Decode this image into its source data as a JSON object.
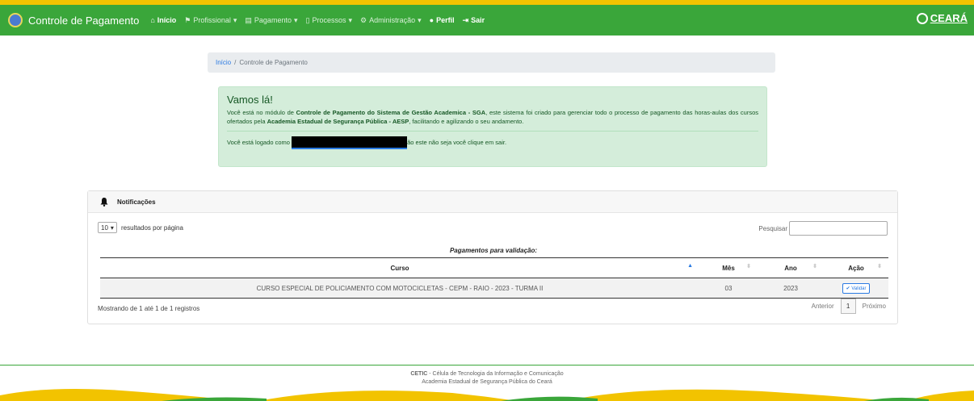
{
  "nav": {
    "brand": "Controle de Pagamento",
    "items": [
      {
        "label": "Início",
        "icon": "home-icon"
      },
      {
        "label": "Profissional",
        "icon": "flag-icon"
      },
      {
        "label": "Pagamento",
        "icon": "money-icon"
      },
      {
        "label": "Processos",
        "icon": "document-icon"
      },
      {
        "label": "Administração",
        "icon": "cogs-icon"
      },
      {
        "label": "Perfil",
        "icon": "user-icon"
      },
      {
        "label": "Sair",
        "icon": "sign-out-icon"
      }
    ],
    "logo_text": "CEARÁ"
  },
  "breadcrumb": {
    "home": "Início",
    "separator": "/",
    "current": "Controle de Pagamento"
  },
  "alert": {
    "title": "Vamos lá!",
    "p1_a": "Você está no módulo de ",
    "p1_b": "Controle de Pagamento do Sistema de Gestão Academica - SGA",
    "p1_c": ", este sistema foi criado para gerenciar todo o processo de pagamento das horas-aulas dos cursos ofertados pela ",
    "p1_d": "Academia Estadual de Segurança Pública - AESP",
    "p1_e": ", facilitando e agilizando o seu andamento.",
    "p2_a": "Você está logado como",
    "p2_b": "ão este não seja você clique em sair."
  },
  "notifications": {
    "title": "Notificações",
    "page_size": "10",
    "page_size_label": "resultados por página",
    "search_label": "Pesquisar",
    "caption": "Pagamentos para validação:",
    "columns": [
      "Curso",
      "Mês",
      "Ano",
      "Ação"
    ],
    "rows": [
      {
        "curso": "CURSO ESPECIAL DE POLICIAMENTO COM MOTOCICLETAS - CEPM - RAIO - 2023 - TURMA II",
        "mes": "03",
        "ano": "2023",
        "acao": "Validar"
      }
    ],
    "info": "Mostrando de 1 até 1 de 1 registros",
    "prev": "Anterior",
    "page": "1",
    "next": "Próximo"
  },
  "footer": {
    "org_abbr": "CETIC",
    "org_rest": " - Célula de Tecnologia da Informação e Comunicação",
    "line2": "Academia Estadual de Segurança Pública do Ceará"
  },
  "colors": {
    "nav_green": "#3aa63a",
    "top_yellow": "#f2c300",
    "alert_bg": "#d4edda",
    "link_blue": "#2a7ae2"
  }
}
